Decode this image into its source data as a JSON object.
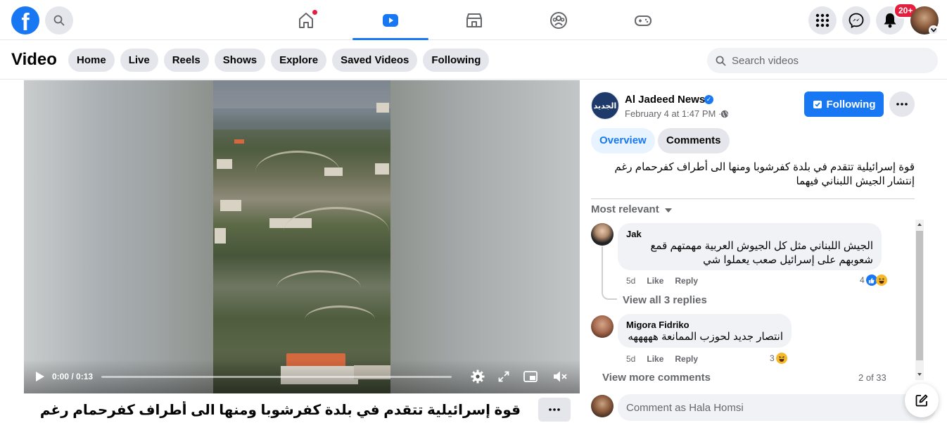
{
  "topbar": {
    "logo_letter": "f",
    "notifications_badge": "20+",
    "nav_tabs": [
      {
        "name": "home",
        "active": false,
        "has_dot": true
      },
      {
        "name": "video",
        "active": true,
        "has_dot": false
      },
      {
        "name": "marketplace",
        "active": false,
        "has_dot": false
      },
      {
        "name": "groups",
        "active": false,
        "has_dot": false
      },
      {
        "name": "gaming",
        "active": false,
        "has_dot": false
      }
    ],
    "accent": "#1877f2"
  },
  "video_header": {
    "title": "Video",
    "pills": [
      "Home",
      "Live",
      "Reels",
      "Shows",
      "Explore",
      "Saved Videos",
      "Following"
    ],
    "search_placeholder": "Search videos"
  },
  "player": {
    "time": "0:00 / 0:13",
    "progress_fraction": 0.0,
    "caption": "قوة إسرائيلية تتقدم في بلدة كفرشوبا ومنها الى أطراف كفرحمام رغم إنتشار الجيش ا..."
  },
  "post": {
    "page_avatar_text": "الجديد",
    "page_name": "Al Jadeed News",
    "date": "February 4 at 1:47 PM ·",
    "following_label": "Following",
    "tabs": {
      "overview": "Overview",
      "comments": "Comments"
    },
    "text": "قوة إسرائيلية تتقدم في بلدة كفرشوبا ومنها الى أطراف كفرحمام رغم إنتشار الجيش اللبناني فيهما",
    "sort_label": "Most relevant"
  },
  "comments": [
    {
      "author": "Jak",
      "text": "الجيش اللبناني مثل كل الجيوش العربية مهمتهم قمع شعوبهم على إسرائيل صعب يعملوا شي",
      "age": "5d",
      "like": "Like",
      "reply": "Reply",
      "reactions": "4",
      "view_replies": "View all 3 replies"
    },
    {
      "author": "Migora Fidriko",
      "text": "انتصار جديد لحوزب الممانعة هههههه",
      "age": "5d",
      "like": "Like",
      "reply": "Reply",
      "reactions": "3"
    }
  ],
  "comments_footer": {
    "view_more": "View more comments",
    "count": "2 of 33",
    "composer_placeholder": "Comment as Hala Homsi"
  }
}
